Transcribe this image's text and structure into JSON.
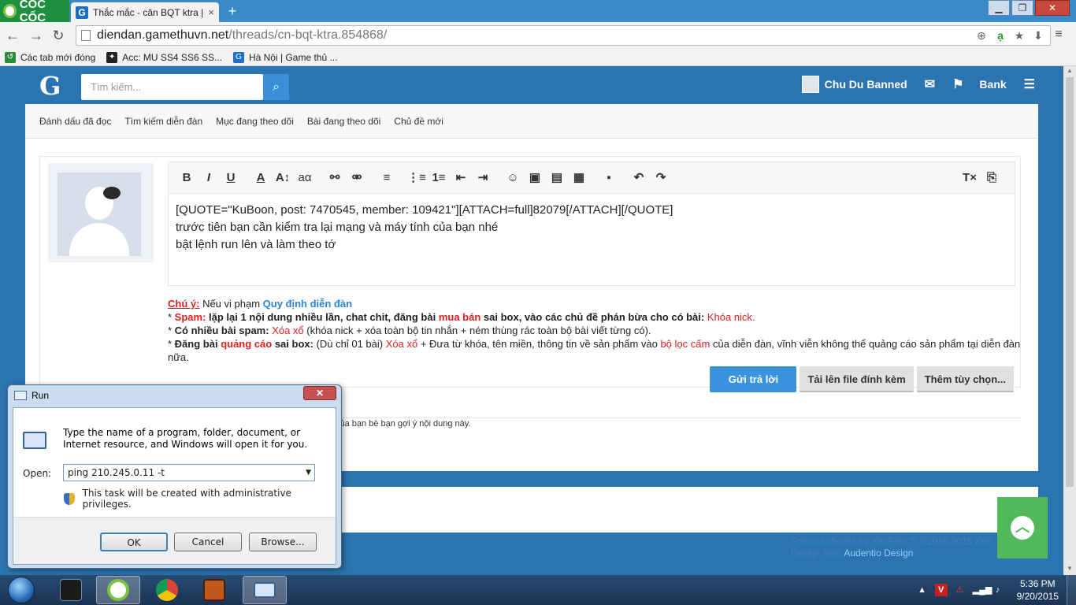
{
  "browser": {
    "brand": "CỐC CỐC",
    "tab_title": "Thắc mắc - căn BQT ktra | G",
    "tab_close": "×",
    "new_tab": "+",
    "url_host": "diendan.gamethuvn.net",
    "url_path": "/threads/cn-bqt-ktra.854868/",
    "bookmarks": [
      {
        "label": "Các tab mới đóng",
        "icon": "recent-tabs-icon",
        "color": "#2a8c3c"
      },
      {
        "label": "Acc: MU SS4 SS6 SS...",
        "icon": "mu-favicon",
        "color": "#222222"
      },
      {
        "label": "Hà Nội | Game thủ ...",
        "icon": "gamethu-favicon",
        "color": "#1f6fc6"
      }
    ]
  },
  "site": {
    "logo": "G",
    "search_placeholder": "Tìm kiếm...",
    "username": "Chu Du Banned",
    "bank_label": "Bank",
    "subnav": [
      "Đánh dấu đã đọc",
      "Tìm kiếm diễn đàn",
      "Mục đang theo dõi",
      "Bài đang theo dõi",
      "Chủ đề mới"
    ]
  },
  "editor": {
    "lines": [
      "[QUOTE=\"KuBoon, post: 7470545, member: 109421\"][ATTACH=full]82079[/ATTACH][/QUOTE]",
      "trước tiên bạn cần kiểm tra lại mạng và máy tính của bạn nhé",
      "bật lệnh run lên và làm theo tớ"
    ]
  },
  "rules": {
    "note_label": "Chú ý:",
    "note_text": " Nếu vi phạm ",
    "note_link": "Quy định diễn đàn",
    "spam_label": "Spam:",
    "spam_text_a": " lặp lại 1 nội dung nhiều lần, chat chit, đăng bài ",
    "spam_mua_ban": "mua bán",
    "spam_text_b": " sai box, vào các chủ đề phán bừa cho có bài: ",
    "spam_penalty": "Khóa nick.",
    "multi_label": "Có nhiều bài spam:",
    "multi_penalty": " Xóa xổ",
    "multi_text": " (khóa nick + xóa toàn bộ tin nhắn + ném thùng rác toàn bộ bài viết từng có).",
    "ads_label_a": "Đăng bài ",
    "ads_label_red": "quảng cáo",
    "ads_label_b": " sai box:",
    "ads_text_a": " (Dù chỉ 01 bài) ",
    "ads_penalty": "Xóa xổ",
    "ads_text_b": " + Đưa từ khóa, tên miền, thông tin về sản phẩm vào ",
    "ads_filter": "bộ lọc cấm",
    "ads_text_c": " của diễn đàn, vĩnh viễn không thể quảng cáo sản phẩm tại diễn đàn nữa."
  },
  "buttons": {
    "submit": "Gửi trả lời",
    "upload": "Tải lên file đính kèm",
    "more": "Thêm tùy chọn..."
  },
  "below_text": "u tiên của bạn bè bạn gợi ý nội dung này.",
  "footer": {
    "line1": "Forum software by XenForo™ ©2010-2015 Xen",
    "line2_prefix": "Design from ",
    "line2_link": "Audentio Design"
  },
  "run_dialog": {
    "title": "Run",
    "close": "✕",
    "message": "Type the name of a program, folder, document, or Internet resource, and Windows will open it for you.",
    "open_label": "Open:",
    "open_value": "ping 210.245.0.11 -t",
    "admin_note": "This task will be created with administrative privileges.",
    "ok": "OK",
    "cancel": "Cancel",
    "browse": "Browse..."
  },
  "taskbar": {
    "time": "5:36 PM",
    "date": "9/20/2015"
  },
  "colors": {
    "site_blue": "#2b74b0",
    "accent_red": "#e02020",
    "link_blue": "#2a84d2",
    "primary_button": "#3a93dd",
    "back_to_top": "#52b95a"
  }
}
